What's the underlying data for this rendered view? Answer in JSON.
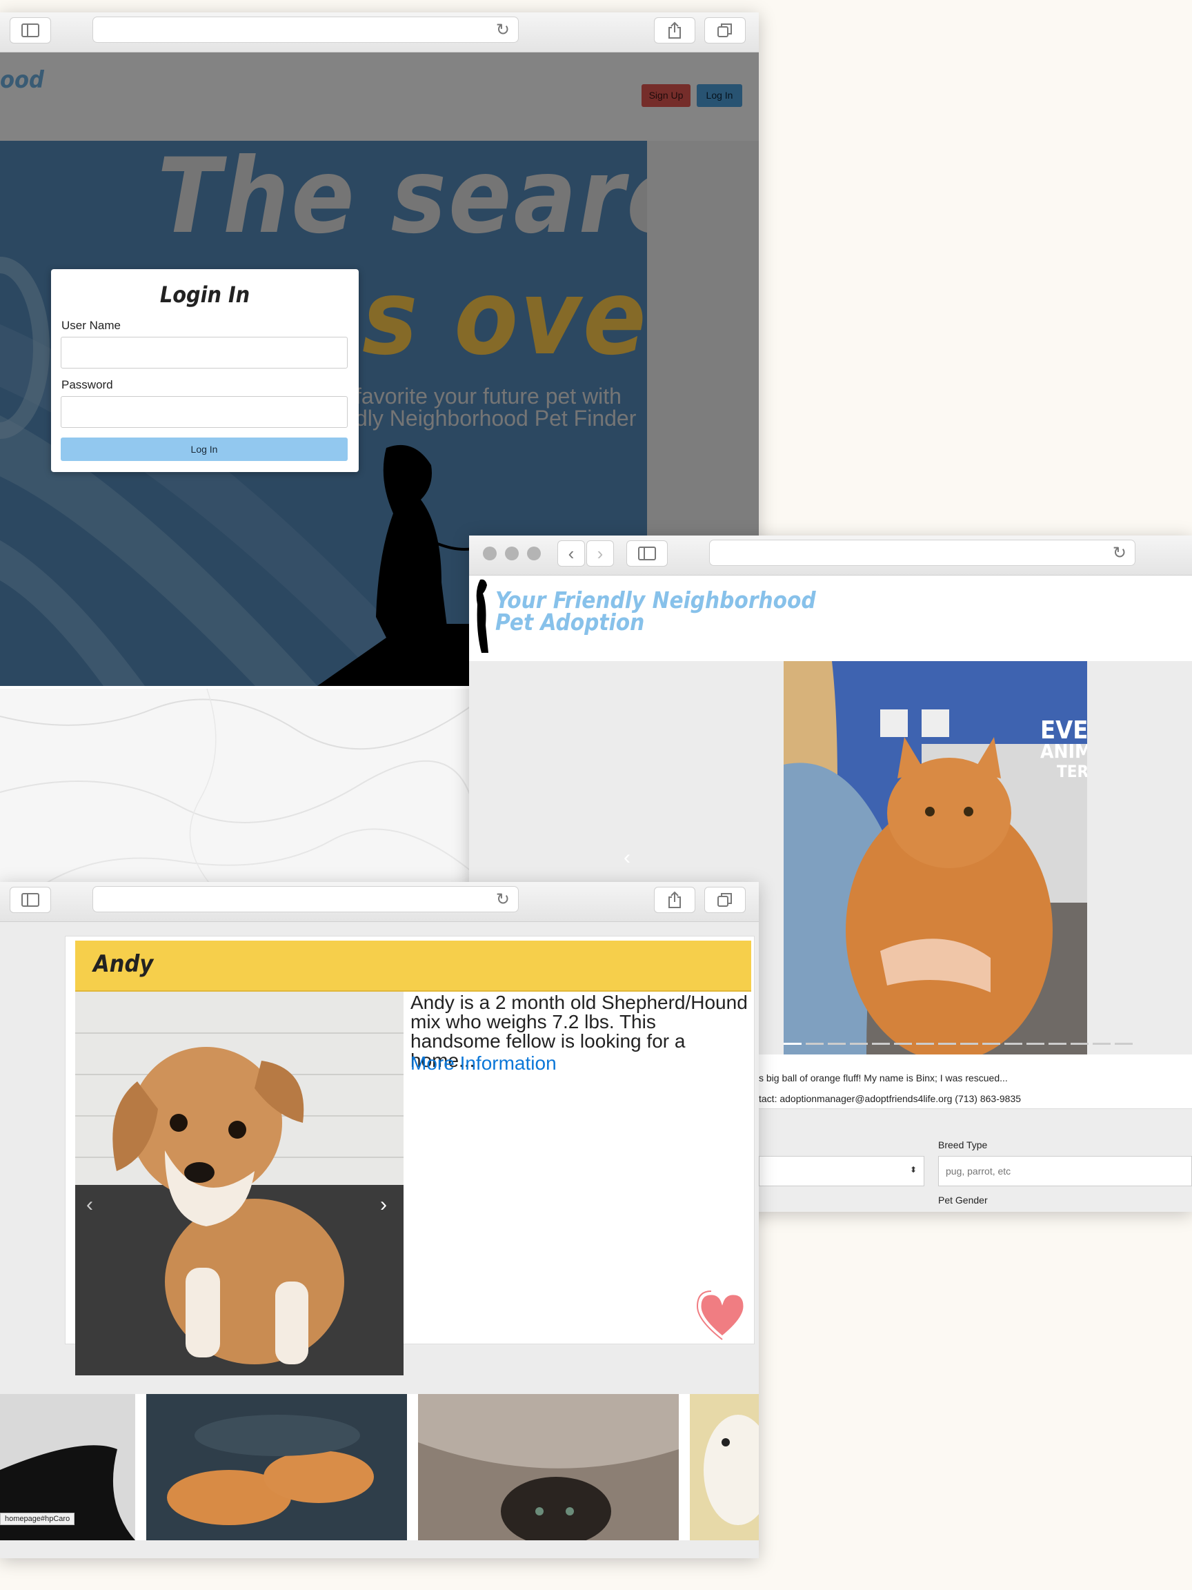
{
  "colors": {
    "page_bg": "#fcf9f3",
    "hero_blue": "#35516d",
    "signup_red": "#a0403f",
    "login_blue": "#2e6e9b",
    "login_button": "#92c8ef",
    "brand_light_blue": "#87c1ea",
    "name_bar_yellow": "#f6cf4b",
    "link_blue": "#0b77d8",
    "heart": "#f07d82"
  },
  "window1": {
    "header": {
      "brand_fragment": "ood",
      "signup_label": "Sign Up",
      "login_label": "Log In"
    },
    "hero": {
      "headline_line1": "The search",
      "headline_line2": "s over",
      "sub_line1": "favorite your future pet with",
      "sub_line2": "dly Neighborhood Pet Finder"
    },
    "login_modal": {
      "title": "Login In",
      "username_label": "User Name",
      "username_value": "",
      "password_label": "Password",
      "password_value": "",
      "submit_label": "Log In"
    }
  },
  "window2": {
    "brand_line1": "Your Friendly Neighborhood",
    "brand_line2": "Pet Adoption",
    "carousel_prev_icon": "chevron-left-icon",
    "photo_sign_line1": "EVER",
    "photo_sign_line2": "ANIMA",
    "photo_sign_line3": "TER",
    "description": "s big ball of orange fluff! My name is Binx; I was rescued...",
    "contact": "tact: adoptionmanager@adoptfriends4life.org (713) 863-9835",
    "breed_label": "Breed Type",
    "breed_placeholder": "pug, parrot, etc",
    "gender_label": "Pet Gender",
    "select_value": ""
  },
  "window3": {
    "pet_name": "Andy",
    "description": "Andy is a 2 month old Shepherd/Hound mix who weighs 7.2 lbs. This handsome fellow is looking for a home...",
    "more_info_link": "More Information",
    "favorite_icon": "heart-icon",
    "status_url": "homepage#hpCaro"
  }
}
